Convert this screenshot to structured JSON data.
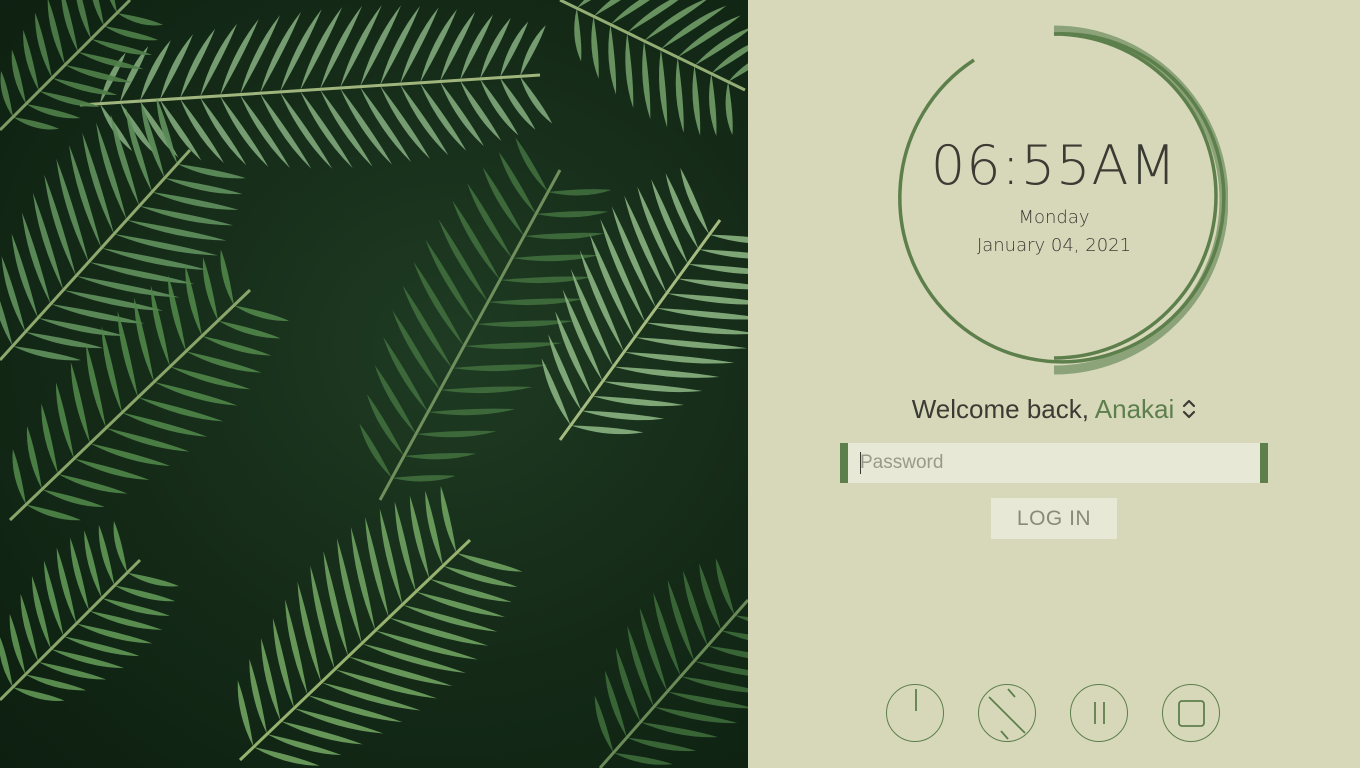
{
  "clock": {
    "time": "06:55AM",
    "day": "Monday",
    "date": "January 04, 2021"
  },
  "login": {
    "welcome_prefix": "Welcome back, ",
    "user_name": "Anakai",
    "user_switch_icon": "chevron-up-down-icon",
    "password_placeholder": "Password",
    "login_label": "LOG IN"
  },
  "power_actions": [
    {
      "name": "shutdown",
      "icon": "power-icon"
    },
    {
      "name": "restart",
      "icon": "restart-icon"
    },
    {
      "name": "suspend",
      "icon": "pause-icon"
    },
    {
      "name": "hibernate",
      "icon": "square-icon"
    }
  ],
  "colors": {
    "panel_background": "#d7d8b9",
    "accent": "#5d7f4c",
    "accent_light": "#8ca37a",
    "text": "#3b3b34",
    "input_background": "#e7e8d6"
  },
  "background_image": "palm-leaves-photo"
}
